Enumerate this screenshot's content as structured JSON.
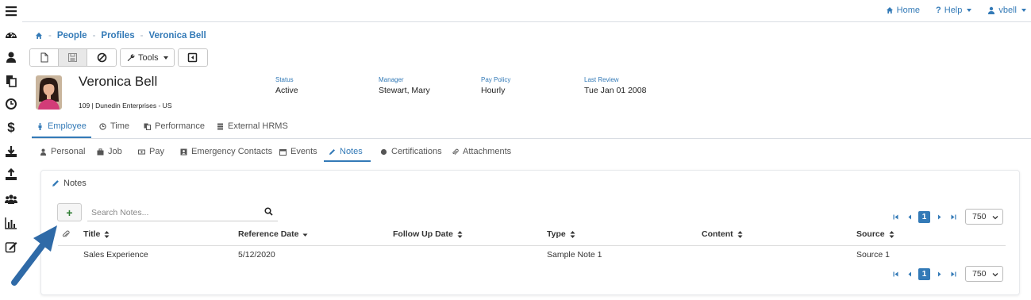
{
  "topnav": {
    "home": "Home",
    "help": "Help",
    "user": "vbell"
  },
  "sidebar": {
    "icons": [
      "menu-icon",
      "dashboard-icon",
      "person-icon",
      "documents-icon",
      "clock-icon",
      "dollar-icon",
      "download-icon",
      "upload-icon",
      "group-icon",
      "bar-chart-icon",
      "edit-icon"
    ]
  },
  "breadcrumb": {
    "home_icon": "home-icon",
    "items": [
      "People",
      "Profiles",
      "Veronica Bell"
    ],
    "separator": "-"
  },
  "toolbar": {
    "tools_label": "Tools"
  },
  "employee": {
    "name": "Veronica Bell",
    "subtitle": "109 | Dunedin Enterprises - US",
    "status_label": "Status",
    "status": "Active",
    "manager_label": "Manager",
    "manager": "Stewart, Mary",
    "paypolicy_label": "Pay Policy",
    "paypolicy": "Hourly",
    "lastreview_label": "Last Review",
    "lastreview": "Tue Jan 01 2008"
  },
  "tabs": [
    "Employee",
    "Time",
    "Performance",
    "External HRMS"
  ],
  "subtabs": [
    "Personal",
    "Job",
    "Pay",
    "Emergency Contacts",
    "Events",
    "Notes",
    "Certifications",
    "Attachments"
  ],
  "active_tab": "Employee",
  "active_subtab": "Notes",
  "notes": {
    "title": "Notes",
    "add_label": "+",
    "search_placeholder": "Search Notes...",
    "page": "1",
    "page_size": "750",
    "columns": [
      "Title",
      "Reference Date",
      "Follow Up Date",
      "Type",
      "Content",
      "Source"
    ],
    "rows": [
      {
        "title": "Sales Experience",
        "reference_date": "5/12/2020",
        "follow_up_date": "",
        "type": "Sample Note 1",
        "content": "",
        "source": "Source 1"
      }
    ]
  },
  "colors": {
    "accent": "#337ab7",
    "add": "#2e7d32",
    "arrow": "#2f6aa7"
  }
}
